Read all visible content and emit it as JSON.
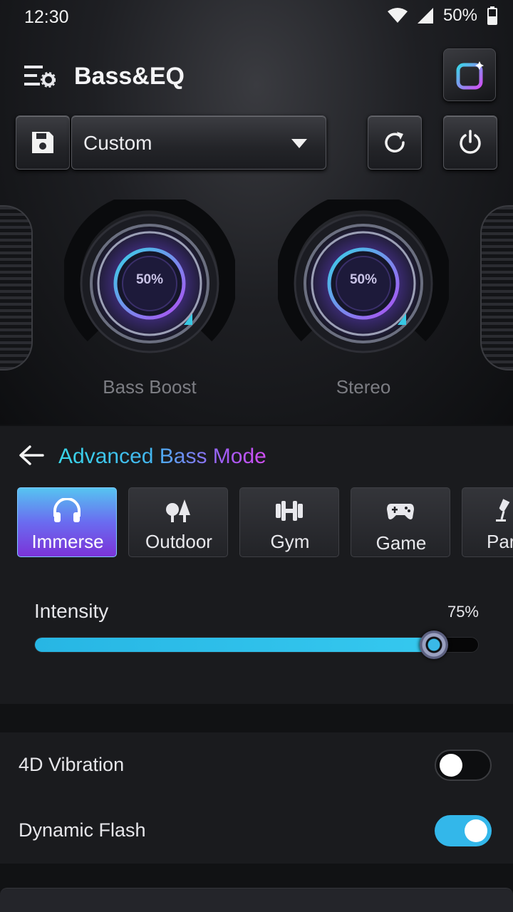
{
  "status_bar": {
    "time": "12:30",
    "battery": "50%"
  },
  "header": {
    "title": "Bass&EQ"
  },
  "preset": {
    "selected": "Custom"
  },
  "knobs": [
    {
      "label": "Bass Boost",
      "value": "50%"
    },
    {
      "label": "Stereo",
      "value": "50%"
    }
  ],
  "advanced": {
    "title": "Advanced Bass Mode",
    "modes": [
      {
        "label": "Immerse",
        "icon": "headphones-icon",
        "active": true
      },
      {
        "label": "Outdoor",
        "icon": "trees-icon",
        "active": false
      },
      {
        "label": "Gym",
        "icon": "dumbbell-icon",
        "active": false
      },
      {
        "label": "Game",
        "icon": "gamepad-icon",
        "active": false
      },
      {
        "label": "Par",
        "icon": "party-glass-icon",
        "active": false
      }
    ],
    "intensity_label": "Intensity",
    "intensity_value": "75%",
    "intensity_level": 0.9
  },
  "toggles": [
    {
      "label": "4D Vibration",
      "on": false
    },
    {
      "label": "Dynamic Flash",
      "on": true
    }
  ],
  "colors": {
    "accent": "#33b7ea",
    "mode_active_start": "#56c4f1",
    "mode_active_end": "#7b33d8"
  }
}
